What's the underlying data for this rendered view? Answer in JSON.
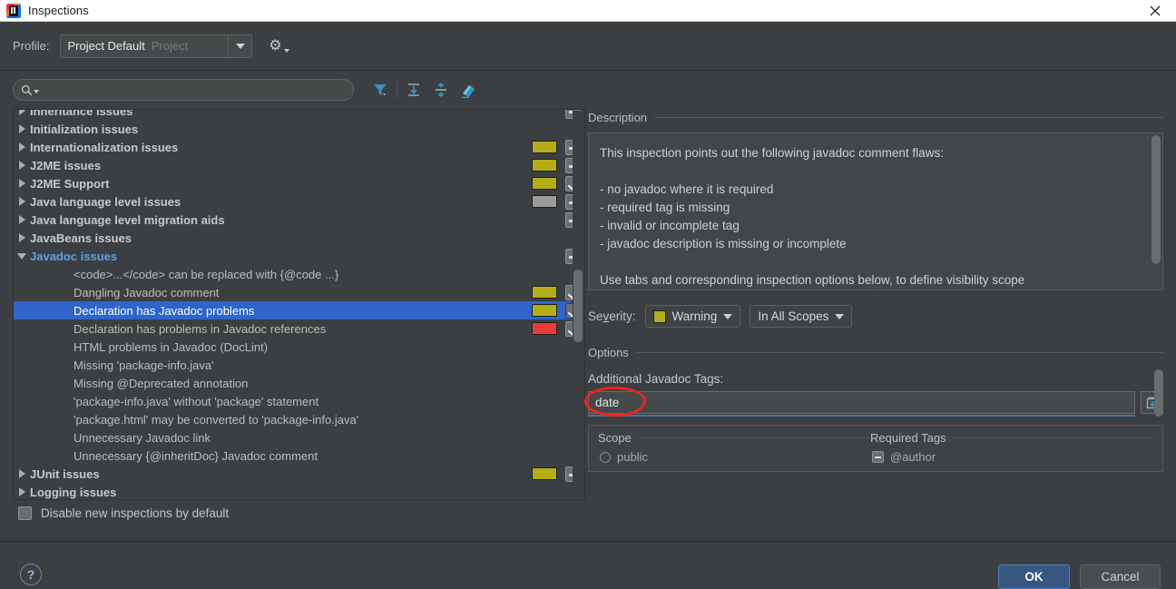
{
  "window": {
    "title": "Inspections",
    "app_icon": "intellij-idea-icon",
    "close_icon": "close-icon"
  },
  "profile_bar": {
    "label": "Profile:",
    "value": "Project Default",
    "scope_suffix": "Project",
    "dropdown_icon": "chevron-down-icon",
    "gear_icon": "gear-icon"
  },
  "toolbar": {
    "search_placeholder": "",
    "search_value": "",
    "search_icon": "search-icon",
    "filter_icon": "filter-funnel-icon",
    "expand_all_icon": "expand-all-icon",
    "collapse_all_icon": "collapse-all-icon",
    "reset_icon": "reset-eraser-icon"
  },
  "tree": {
    "rows": [
      {
        "label": "Inheritance issues",
        "type": "group",
        "indent": 0,
        "expanded": false,
        "checkbox": "dash",
        "severity": null
      },
      {
        "label": "Initialization issues",
        "type": "group",
        "indent": 0,
        "expanded": false,
        "checkbox": "none",
        "severity": null
      },
      {
        "label": "Internationalization issues",
        "type": "group",
        "indent": 0,
        "expanded": false,
        "checkbox": "dash",
        "severity": "#b3ae16"
      },
      {
        "label": "J2ME issues",
        "type": "group",
        "indent": 0,
        "expanded": false,
        "checkbox": "dash",
        "severity": "#b3ae16"
      },
      {
        "label": "J2ME Support",
        "type": "group",
        "indent": 0,
        "expanded": false,
        "checkbox": "check",
        "severity": "#b3ae16"
      },
      {
        "label": "Java language level issues",
        "type": "group",
        "indent": 0,
        "expanded": false,
        "checkbox": "dash",
        "severity": "#9a9a9a"
      },
      {
        "label": "Java language level migration aids",
        "type": "group",
        "indent": 0,
        "expanded": false,
        "checkbox": "dash",
        "severity": null
      },
      {
        "label": "JavaBeans issues",
        "type": "group",
        "indent": 0,
        "expanded": false,
        "checkbox": "none",
        "severity": null
      },
      {
        "label": "Javadoc issues",
        "type": "open",
        "indent": 0,
        "expanded": true,
        "checkbox": "dash",
        "severity": null
      },
      {
        "label": "<code>...</code> can be replaced with {@code ...}",
        "type": "leaf",
        "indent": 1,
        "expanded": false,
        "checkbox": "none",
        "severity": null
      },
      {
        "label": "Dangling Javadoc comment",
        "type": "leaf",
        "indent": 1,
        "expanded": false,
        "checkbox": "check",
        "severity": "#b3ae16"
      },
      {
        "label": "Declaration has Javadoc problems",
        "type": "leaf",
        "indent": 1,
        "expanded": false,
        "checkbox": "check",
        "severity": "#b3ae16",
        "selected": true
      },
      {
        "label": "Declaration has problems in Javadoc references",
        "type": "leaf",
        "indent": 1,
        "expanded": false,
        "checkbox": "check",
        "severity": "#ec3b3b"
      },
      {
        "label": "HTML problems in Javadoc (DocLint)",
        "type": "leaf",
        "indent": 1,
        "expanded": false,
        "checkbox": "none",
        "severity": null
      },
      {
        "label": "Missing 'package-info.java'",
        "type": "leaf",
        "indent": 1,
        "expanded": false,
        "checkbox": "none",
        "severity": null
      },
      {
        "label": "Missing @Deprecated annotation",
        "type": "leaf",
        "indent": 1,
        "expanded": false,
        "checkbox": "none",
        "severity": null
      },
      {
        "label": "'package-info.java' without 'package' statement",
        "type": "leaf",
        "indent": 1,
        "expanded": false,
        "checkbox": "none",
        "severity": null
      },
      {
        "label": "'package.html' may be converted to 'package-info.java'",
        "type": "leaf",
        "indent": 1,
        "expanded": false,
        "checkbox": "none",
        "severity": null
      },
      {
        "label": "Unnecessary Javadoc link",
        "type": "leaf",
        "indent": 1,
        "expanded": false,
        "checkbox": "none",
        "severity": null
      },
      {
        "label": "Unnecessary {@inheritDoc} Javadoc comment",
        "type": "leaf",
        "indent": 1,
        "expanded": false,
        "checkbox": "none",
        "severity": null
      },
      {
        "label": "JUnit issues",
        "type": "group",
        "indent": 0,
        "expanded": false,
        "checkbox": "dash",
        "severity": "#b3ae16"
      },
      {
        "label": "Logging issues",
        "type": "group",
        "indent": 0,
        "expanded": false,
        "checkbox": "none",
        "severity": null
      }
    ]
  },
  "description": {
    "title": "Description",
    "body": "This inspection points out the following javadoc comment flaws:\n\n- no javadoc where it is required\n- required tag is missing\n- invalid or incomplete tag\n- javadoc description is missing or incomplete\n\nUse tabs and corresponding inspection options below, to define visibility scope"
  },
  "severity": {
    "label_prefix": "Se",
    "label_mnemonic": "v",
    "label_suffix": "erity:",
    "value": "Warning",
    "color": "#b3ae16",
    "scope_value": "In All Scopes",
    "dropdown_icon": "chevron-down-icon"
  },
  "options": {
    "title": "Options",
    "tags_label": "Additional Javadoc Tags:",
    "tags_value": "date",
    "tags_button_icon": "insert-expand-icon",
    "annotation": "red-circle-highlight",
    "table": {
      "columns": [
        "Scope",
        "Required Tags"
      ],
      "rows": [
        {
          "scope": "public",
          "scope_control": "radio",
          "tag": "@author",
          "tag_control": "checkbox-dash"
        }
      ]
    }
  },
  "footer": {
    "disable_label": "Disable new inspections by default",
    "disable_checked": false,
    "help_icon": "help-question-icon",
    "help_label": "?",
    "ok_label": "OK",
    "cancel_label": "Cancel"
  },
  "colors": {
    "accent": "#2f65ca",
    "warning": "#b3ae16",
    "error": "#ec3b3b",
    "neutral": "#9a9a9a",
    "link": "#5b9fe8",
    "annotation_red": "#ee2222",
    "bg": "#3c3f41"
  }
}
